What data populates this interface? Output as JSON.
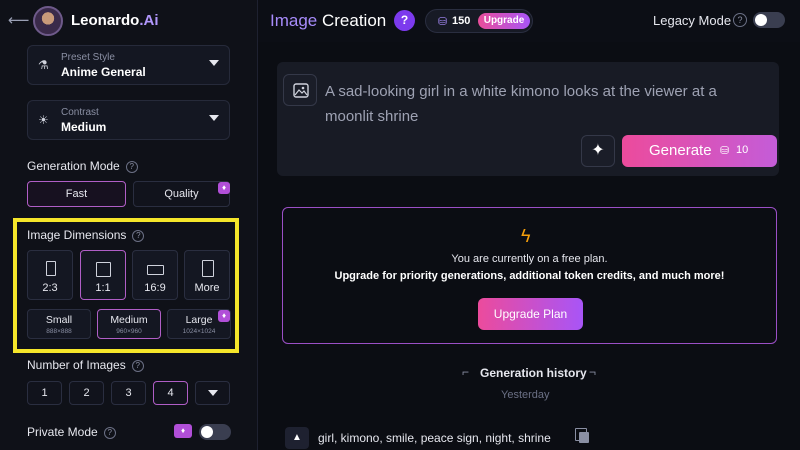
{
  "header": {
    "logo_name": "Leonardo",
    "logo_suffix": ".Ai",
    "title_part1": "Image",
    "title_part2": " Creation",
    "help_label": "?",
    "tokens": "150",
    "upgrade_label": "Upgrade",
    "legacy_label": "Legacy Mode"
  },
  "sidebar": {
    "preset": {
      "sub": "Preset Style",
      "value": "Anime General"
    },
    "contrast": {
      "sub": "Contrast",
      "value": "Medium"
    },
    "generation_mode": {
      "label": "Generation Mode",
      "options": [
        "Fast",
        "Quality"
      ],
      "selected": "Fast"
    },
    "image_dimensions": {
      "label": "Image Dimensions",
      "ratios": [
        "2:3",
        "1:1",
        "16:9",
        "More"
      ],
      "selected_ratio": "1:1",
      "sizes": [
        {
          "label": "Small",
          "px": "888×888"
        },
        {
          "label": "Medium",
          "px": "960×960"
        },
        {
          "label": "Large",
          "px": "1024×1024"
        }
      ],
      "selected_size": "Medium"
    },
    "number_of_images": {
      "label": "Number of Images",
      "options": [
        "1",
        "2",
        "3",
        "4"
      ],
      "selected": "4"
    },
    "private_mode": {
      "label": "Private Mode",
      "enabled": false
    }
  },
  "prompt": {
    "text": "A sad-looking girl in a white kimono looks at the viewer at a moonlit shrine",
    "generate_label": "Generate",
    "generate_cost": "10"
  },
  "upgrade_banner": {
    "line1": "You are currently on a free plan.",
    "line2": "Upgrade for priority generations, additional token credits, and much more!",
    "button_label": "Upgrade Plan"
  },
  "history": {
    "title": "Generation history",
    "subtitle": "Yesterday",
    "items": [
      {
        "prompt": "girl, kimono, smile, peace sign, night, shrine"
      }
    ]
  },
  "colors": {
    "accent_pink": "#ec4b9c",
    "accent_purple": "#a855f7",
    "highlight_yellow": "#f5e62a",
    "background": "#0b0d13"
  }
}
